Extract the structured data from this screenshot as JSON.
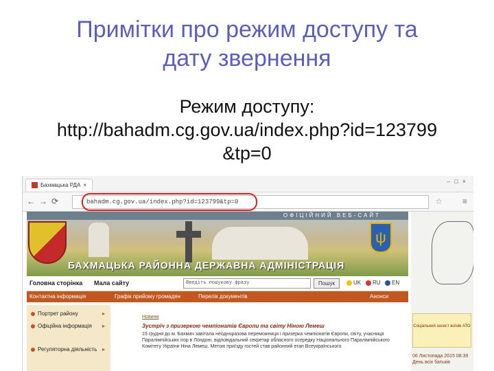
{
  "slide": {
    "title_line1": "Примітки про режим доступу та",
    "title_line2": "дату звернення",
    "body_line1": "Режим доступу:",
    "body_line2": "http://bahadm.cg.gov.ua/index.php?id=123799",
    "body_line3": "&tp=0"
  },
  "browser": {
    "tab_title": "Бахмацька РДА",
    "address": "bahadm.cg.gov.ua/index.php?id=123799&tp=0",
    "highlight_color": "#e11b1b"
  },
  "site": {
    "top_strip": "ОФІЦІЙНИЙ ВЕБ-САЙТ",
    "title": "БАХМАЦЬКА РАЙОННА ДЕРЖАВНА АДМІНІСТРАЦІЯ",
    "nav": {
      "home": "Головна сторінка",
      "sitemap": "Мала сайту",
      "search_value": "Введіть пошукову фразу",
      "search_button": "Пошук",
      "langs": [
        "UK",
        "RU",
        "EN"
      ]
    },
    "orange_menu": [
      "Контактна інформація",
      "Графік прийому громадян",
      "Перелік документів",
      "Анонси"
    ],
    "left_menu": [
      {
        "label": "Портрет району"
      },
      {
        "label": "Офіційна інформація"
      },
      {
        "label": "Регуляторна діяльність"
      }
    ],
    "news": {
      "date": "Новини",
      "title": "Зустріч з призеркою чемпіонатів Європи та світу Ніною Лемеш",
      "text": "15 грудня до м. Бахмач завітала неодноразова переможниця і призерка чемпіонатів Європи, світу, учасниця Паралімпійських ігор в Лондоні, відповідальний секретар обласного осередку Національного Паралімпійського Комітету України Ніна Лемеш. Метою приїзду гостей став районний етап Всеукраїнського"
    },
    "side_box": "Соціальний захист воїнів АТО",
    "side_date": "06 Листопада 2015 08:39 День всіх батьків"
  }
}
